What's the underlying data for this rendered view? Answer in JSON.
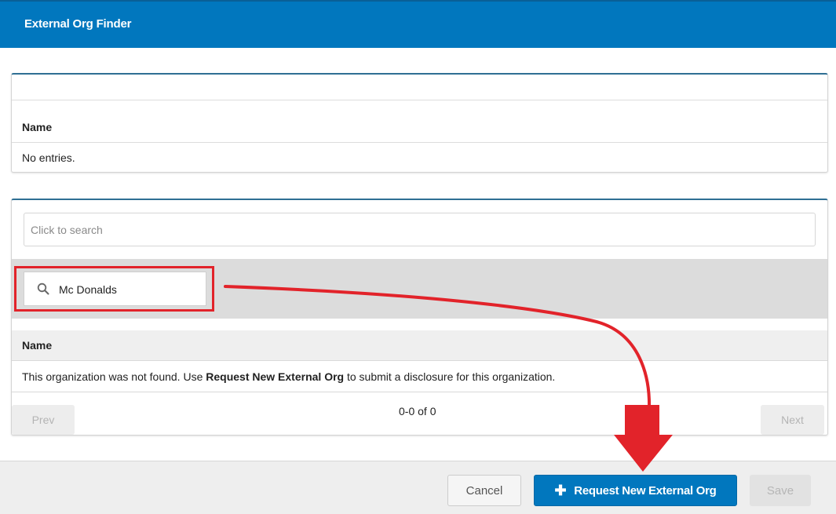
{
  "header": {
    "title": "External Org Finder"
  },
  "selected_panel": {
    "column_name": "Name",
    "empty_text": "No entries."
  },
  "search_panel": {
    "search_placeholder": "Click to search",
    "filter_value": "Mc Donalds",
    "column_name": "Name",
    "not_found": {
      "prefix": "This organization was not found. Use ",
      "link_text": "Request New External Org",
      "suffix": " to submit a disclosure for this organization."
    },
    "pager": {
      "prev_label": "Prev",
      "page_info": "0-0 of 0",
      "next_label": "Next"
    }
  },
  "footer": {
    "cancel_label": "Cancel",
    "request_label": "Request New External Org",
    "save_label": "Save"
  },
  "annotation": {
    "color": "#e2232a"
  },
  "colors": {
    "header": "#0177be",
    "primary_button": "#0177be",
    "highlight": "#e2232a"
  }
}
